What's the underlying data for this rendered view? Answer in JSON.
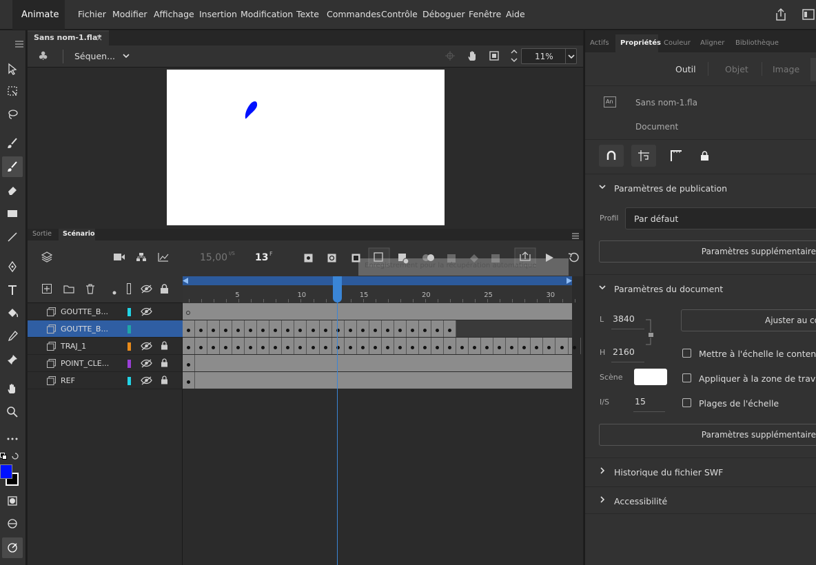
{
  "app": {
    "name": "Animate"
  },
  "menu": [
    "Fichier",
    "Modifier",
    "Affichage",
    "Insertion",
    "Modification",
    "Texte",
    "Commandes",
    "Contrôle",
    "Déboguer",
    "Fenêtre",
    "Aide"
  ],
  "document_tab": {
    "title": "Sans nom-1.fla*"
  },
  "editbar": {
    "scene": "Séquen...",
    "zoom": "11%"
  },
  "timeline": {
    "tabs": [
      "Sortie",
      "Scénario"
    ],
    "fps": "15,00",
    "fps_unit": "I/S",
    "frame": "13",
    "frame_unit": "F",
    "tooltip": "Enregistrement pour la récupération automatique",
    "ruler_labels": [
      "5",
      "10",
      "15",
      "20",
      "25",
      "30"
    ],
    "layers": [
      {
        "name": "GOUTTE_B...",
        "color": "#22d3e6",
        "selected": false
      },
      {
        "name": "GOUTTE_B...",
        "color": "#20a6a6",
        "selected": true
      },
      {
        "name": "TRAJ_1",
        "color": "#e88a1a",
        "selected": false
      },
      {
        "name": "POINT_CLE...",
        "color": "#9b3fd6",
        "selected": false
      },
      {
        "name": "REF",
        "color": "#22d3e6",
        "selected": false
      }
    ]
  },
  "properties": {
    "tabs": [
      "Actifs",
      "Propriétés",
      "Couleur",
      "Aligner",
      "Bibliothèque"
    ],
    "subtabs": [
      "Outil",
      "Objet",
      "Image"
    ],
    "doc_name": "Sans nom-1.fla",
    "doc_type": "Document",
    "doc_badge": "An",
    "publish_section": "Paramètres de publication",
    "profile_label": "Profil",
    "profile_value": "Par défaut",
    "more_params": "Paramètres supplémentaires",
    "doc_section": "Paramètres du document",
    "width_label": "L",
    "width_value": "3840",
    "height_label": "H",
    "height_value": "2160",
    "fit_button": "Ajuster au co",
    "scale_content": "Mettre à l'échelle le contenu",
    "apply_workarea": "Appliquer à la zone de travail",
    "scale_ranges": "Plages de l'échelle",
    "stage_label": "Scène",
    "stage_color": "#ffffff",
    "fps_label": "I/S",
    "fps_value": "15",
    "more_params_2": "Paramètres supplémentaires",
    "swf_history": "Historique du fichier SWF",
    "accessibility": "Accessibilité"
  },
  "colors": {
    "fill": "#0011ff",
    "stroke": "#000000",
    "accent": "#2c5a9c",
    "selected_layer": "#2f5ea3"
  }
}
